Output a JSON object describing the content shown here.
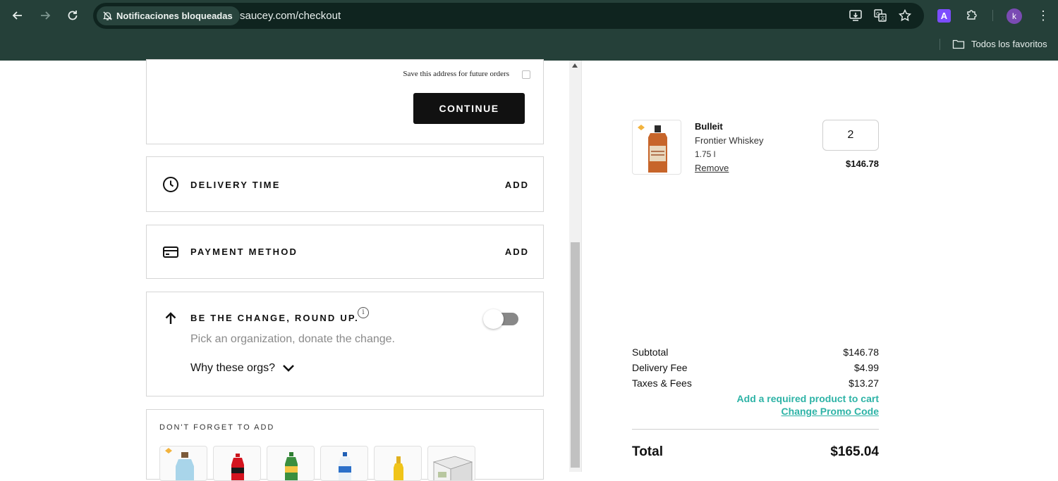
{
  "browser": {
    "site_chip": "Notificaciones bloqueadas",
    "url": "saucey.com/checkout",
    "extension_label": "A",
    "profile_initial": "k",
    "bookmarks_label": "Todos los favoritos"
  },
  "address": {
    "save_label": "Save this address for future orders",
    "save_checked": false,
    "continue_label": "CONTINUE"
  },
  "delivery": {
    "title": "DELIVERY TIME",
    "action": "ADD"
  },
  "payment": {
    "title": "PAYMENT METHOD",
    "action": "ADD"
  },
  "roundup": {
    "title": "BE THE CHANGE, ROUND UP.",
    "info": "i",
    "subtitle": "Pick an organization, donate the change.",
    "why_label": "Why these orgs?",
    "toggle_on": false
  },
  "dont_forget": {
    "title": "DON'T FORGET TO ADD",
    "items": [
      "water-bottle",
      "cola-bottle",
      "ginger-ale-bottle",
      "sparkling-water-bottle",
      "beer-bottle",
      "mixer-pack"
    ]
  },
  "cart": {
    "product": {
      "name": "Bulleit",
      "description": "Frontier Whiskey",
      "size": "1.75 l",
      "remove_label": "Remove",
      "quantity": "2",
      "price": "$146.78"
    },
    "summary": {
      "subtotal_label": "Subtotal",
      "subtotal": "$146.78",
      "delivery_label": "Delivery Fee",
      "delivery": "$4.99",
      "taxes_label": "Taxes & Fees",
      "taxes": "$13.27",
      "promo_required": "Add a required product to cart",
      "promo_change": "Change Promo Code",
      "total_label": "Total",
      "total": "$165.04"
    }
  },
  "colors": {
    "chrome": "#254039",
    "omnibox": "#0f241f",
    "accent": "#2db3a6",
    "button": "#111111"
  }
}
